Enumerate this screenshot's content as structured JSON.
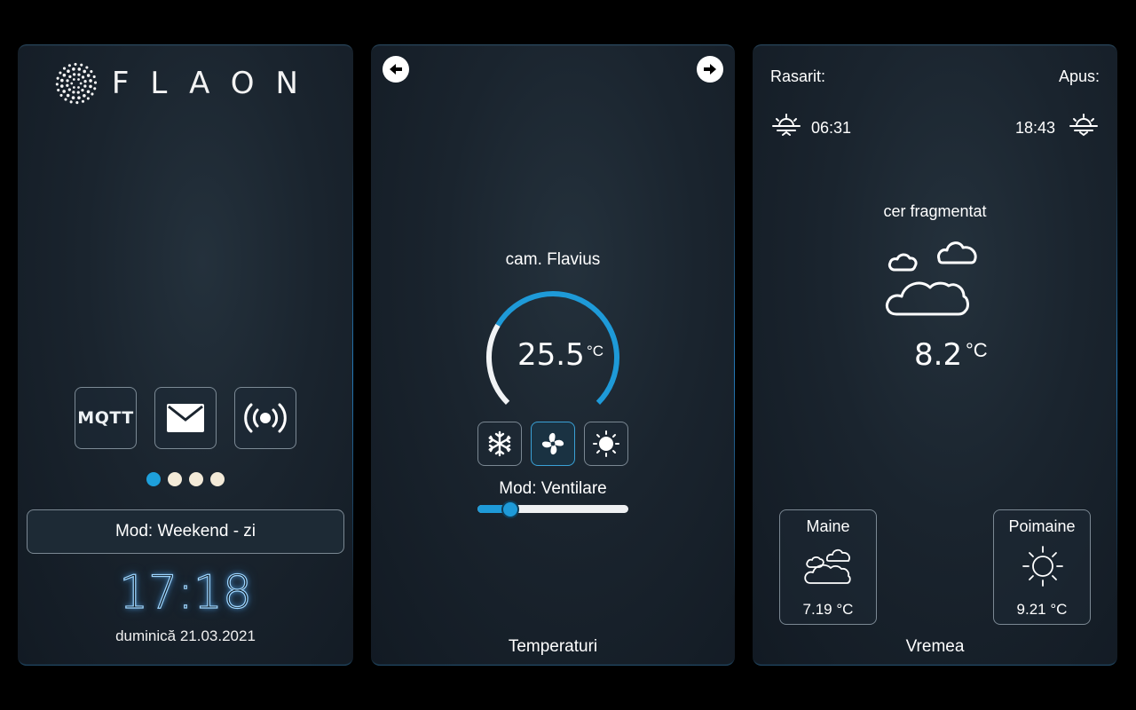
{
  "home": {
    "logo_text": "FLAON",
    "buttons": {
      "mqtt_label": "MQTT"
    },
    "mode_label": "Mod: Weekend - zi",
    "time": "17:18",
    "date": "duminică 21.03.2021",
    "page_dots": {
      "count": 4,
      "active_index": 0
    }
  },
  "thermostat": {
    "room_name": "cam. Flavius",
    "temperature": "25.5",
    "unit": "°C",
    "gauge_fill_fraction": 0.72,
    "modes": [
      "snowflake-icon",
      "fan-icon",
      "sun-icon"
    ],
    "active_mode_index": 1,
    "mode_label": "Mod: Ventilare",
    "slider_value_fraction": 0.22,
    "footer": "Temperaturi"
  },
  "weather": {
    "sunrise_label": "Rasarit:",
    "sunset_label": "Apus:",
    "sunrise_time": "06:31",
    "sunset_time": "18:43",
    "condition": "cer fragmentat",
    "temperature": "8.2",
    "unit": "°C",
    "forecast": [
      {
        "day": "Maine",
        "temp": "7.19 °C",
        "icon": "cloudy-icon"
      },
      {
        "day": "Poimaine",
        "temp": "9.21 °C",
        "icon": "sun-icon"
      }
    ],
    "footer": "Vremea"
  },
  "colors": {
    "accent": "#1e9ad8",
    "panel": "#1a242e",
    "border": "#7b8893"
  }
}
